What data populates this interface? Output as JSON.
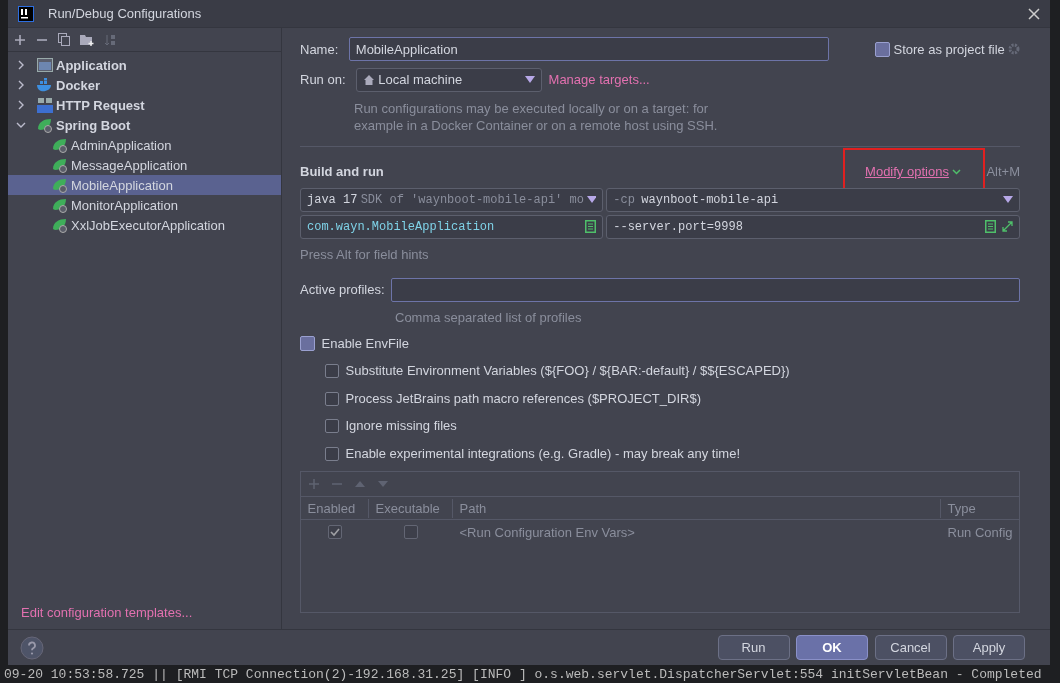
{
  "window": {
    "title": "Run/Debug Configurations"
  },
  "tree": [
    {
      "label": "Application",
      "kind": "application",
      "expanded": false,
      "selected": false
    },
    {
      "label": "Docker",
      "kind": "docker",
      "expanded": false,
      "selected": false
    },
    {
      "label": "HTTP Request",
      "kind": "http",
      "expanded": false,
      "selected": false
    },
    {
      "label": "Spring Boot",
      "kind": "spring",
      "expanded": true,
      "selected": false,
      "children": [
        {
          "label": "AdminApplication",
          "selected": false
        },
        {
          "label": "MessageApplication",
          "selected": false
        },
        {
          "label": "MobileApplication",
          "selected": true
        },
        {
          "label": "MonitorApplication",
          "selected": false
        },
        {
          "label": "XxlJobExecutorApplication",
          "selected": false
        }
      ]
    }
  ],
  "templates_link": "Edit configuration templates...",
  "form": {
    "name": {
      "label": "Name:",
      "value": "MobileApplication"
    },
    "store_as_project_file": {
      "label": "Store as project file",
      "checked": false
    },
    "run_on": {
      "label": "Run on:",
      "value": "Local machine"
    },
    "manage_targets": "Manage targets...",
    "run_on_hint": "Run configurations may be executed locally or on a target: for example in a Docker Container or on a remote host using SSH.",
    "section_title": "Build and run",
    "modify_options": {
      "label": "Modify options",
      "shortcut": "Alt+M",
      "highlighted": true
    },
    "jdk": {
      "value": "java 17",
      "hint": "SDK of 'waynboot-mobile-api' mo"
    },
    "classpath": {
      "prefix": "-cp",
      "value": "waynboot-mobile-api"
    },
    "main_class": "com.wayn.MobileApplication",
    "program_args": "--server.port=9998",
    "field_hints_note": "Press Alt for field hints",
    "active_profiles": {
      "label": "Active profiles:"
    },
    "profiles_hint": "Comma separated list of profiles",
    "envfile": {
      "label": "Enable EnvFile",
      "checked": false
    },
    "env_options": [
      {
        "label": "Substitute Environment Variables (${FOO} / ${BAR:-default} / $${ESCAPED})",
        "checked": false
      },
      {
        "label": "Process JetBrains path macro references ($PROJECT_DIR$)",
        "checked": false
      },
      {
        "label": "Ignore missing files",
        "checked": false
      },
      {
        "label": "Enable experimental integrations (e.g. Gradle) - may break any time!",
        "checked": false
      }
    ],
    "env_table": {
      "columns": [
        "Enabled",
        "Executable",
        "Path",
        "Type"
      ],
      "rows": [
        {
          "enabled": true,
          "executable": false,
          "path": "<Run Configuration Env Vars>",
          "type": "Run Config"
        }
      ]
    }
  },
  "buttons": [
    {
      "label": "Run",
      "kind": "default"
    },
    {
      "label": "OK",
      "kind": "primary"
    },
    {
      "label": "Cancel",
      "kind": "default"
    },
    {
      "label": "Apply",
      "kind": "default"
    }
  ],
  "log_line": "09-20 10:53:58.725 || [RMI TCP Connection(2)-192.168.31.25] [INFO ] o.s.web.servlet.DispatcherServlet:554 initServletBean - Completed"
}
